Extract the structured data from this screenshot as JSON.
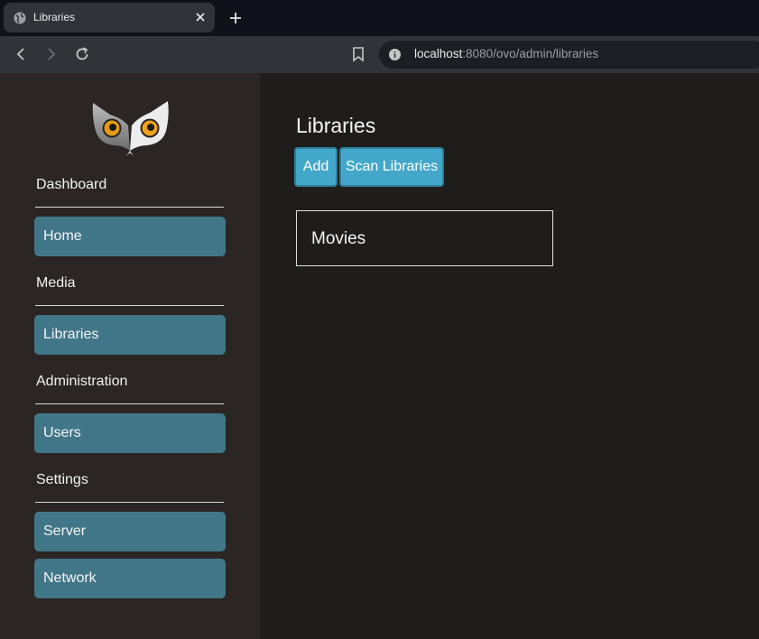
{
  "browser": {
    "tab_title": "Libraries",
    "url_host": "localhost",
    "url_rest": ":8080/ovo/admin/libraries"
  },
  "sidebar": {
    "sections": [
      {
        "label": "Dashboard",
        "items": [
          "Home"
        ]
      },
      {
        "label": "Media",
        "items": [
          "Libraries"
        ]
      },
      {
        "label": "Administration",
        "items": [
          "Users"
        ]
      },
      {
        "label": "Settings",
        "items": [
          "Server",
          "Network"
        ]
      }
    ]
  },
  "main": {
    "title": "Libraries",
    "add_label": "Add",
    "scan_label": "Scan Libraries",
    "libraries": [
      "Movies"
    ]
  },
  "colors": {
    "nav_item": "#417688",
    "button": "#42a7c9",
    "sidebar_bg": "#2b2624",
    "main_bg": "#1e1d1b"
  }
}
